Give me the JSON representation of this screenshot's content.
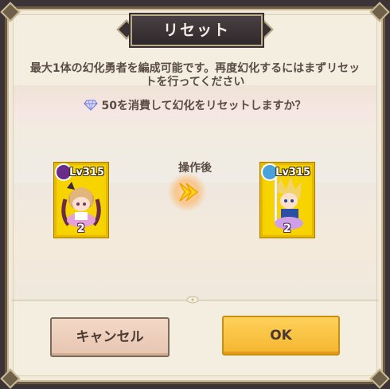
{
  "dialog": {
    "title": "リセット",
    "message": "最大1体の幻化勇者を編成可能です。再度幻化するにはまずリセットを行ってください",
    "confirm_text": "50を消費して幻化をリセットしますか？",
    "cost_icon": "diamond-icon"
  },
  "before_card": {
    "level": "Lv315",
    "stars": "2",
    "element_icon": "dark-element-icon",
    "element_color": "#6a2c8a"
  },
  "operation_label": "操作後",
  "after_card": {
    "level": "Lv315",
    "stars": "2",
    "element_icon": "water-element-icon",
    "element_color": "#4aa3d8"
  },
  "buttons": {
    "cancel_label": "キャンセル",
    "ok_label": "OK"
  },
  "colors": {
    "frame_gold": "#f4d100",
    "ok_button": "#f4b52e",
    "cancel_button": "#ecceba",
    "title_plate": "#3a3134"
  }
}
